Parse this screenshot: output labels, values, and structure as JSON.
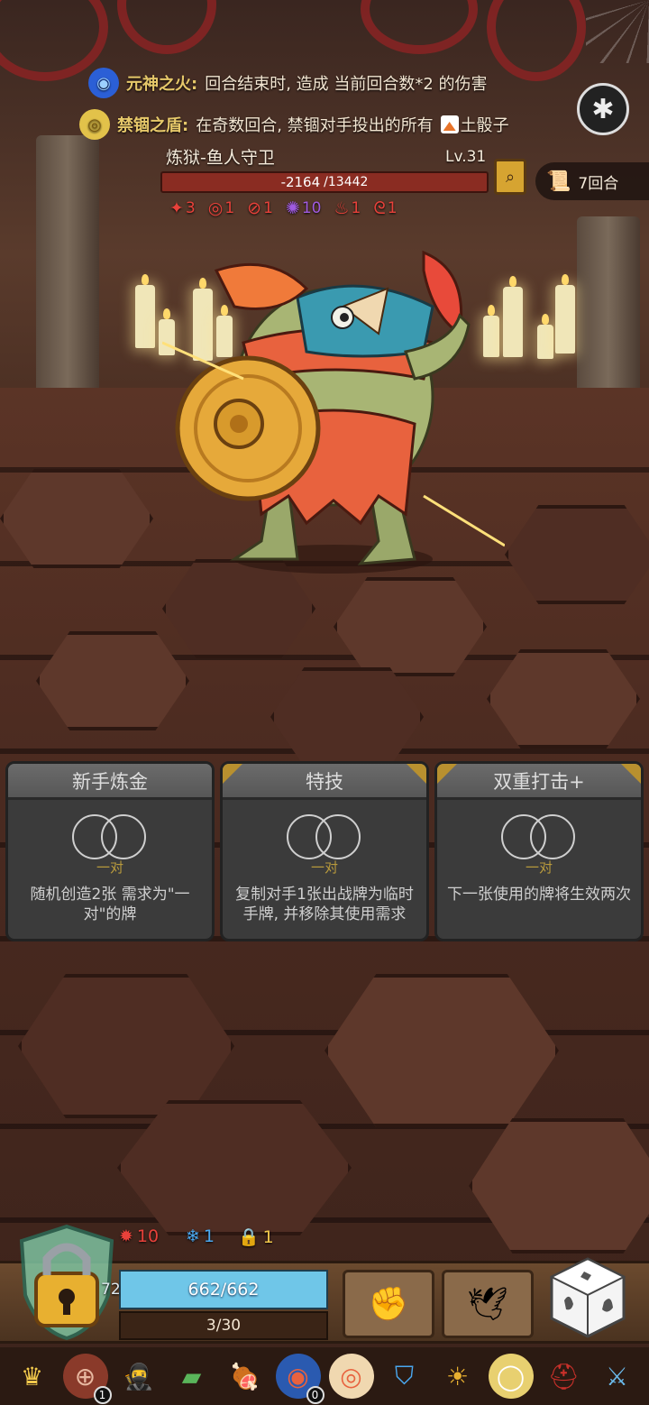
{
  "passives": [
    {
      "icon": "spirit-fire-icon",
      "name": "元神之火:",
      "text": "回合结束时, 造成 当前回合数*2 的伤害"
    },
    {
      "icon": "seal-shield-icon",
      "name": "禁锢之盾:",
      "text": "在奇数回合, 禁锢对手投出的所有",
      "dice_label": "土骰子"
    }
  ],
  "enemy": {
    "name": "炼狱-鱼人守卫",
    "level": "Lv.31",
    "hp_change": "-2164",
    "hp_max": "/13442",
    "hp_fraction": 0.84,
    "round_label": "7回合",
    "statuses": [
      {
        "icon": "burn-icon",
        "value": "3",
        "color": "#e8413a"
      },
      {
        "icon": "spiral-icon",
        "value": "1",
        "color": "#e8413a"
      },
      {
        "icon": "slash-icon",
        "value": "1",
        "color": "#e8413a"
      },
      {
        "icon": "poison-splat-icon",
        "value": "10",
        "color": "#a05be0"
      },
      {
        "icon": "rage-icon",
        "value": "1",
        "color": "#e8413a"
      },
      {
        "icon": "tentacle-icon",
        "value": "1",
        "color": "#e8413a"
      }
    ]
  },
  "cards": [
    {
      "title": "新手炼金",
      "requirement": "一对",
      "description": "随机创造2张 需求为\"一对\"的牌",
      "gold": false
    },
    {
      "title": "特技",
      "requirement": "一对",
      "description": "复制对手1张出战牌为临时手牌, 并移除其使用需求",
      "gold": true
    },
    {
      "title": "双重打击+",
      "requirement": "一对",
      "description": "下一张使用的牌将生效两次",
      "gold": true
    }
  ],
  "player": {
    "statuses": [
      {
        "icon": "burn-gear-icon",
        "value": "10",
        "color": "#e8413a"
      },
      {
        "icon": "snowflake-icon",
        "value": "1",
        "color": "#4aa8f0"
      },
      {
        "icon": "lock-icon",
        "value": "1",
        "color": "#f2c94c"
      }
    ],
    "shield_value": "72",
    "hp": "662/662",
    "hp_fraction": 1.0,
    "energy": "3/30",
    "energy_fraction": 0.1
  },
  "relics": [
    {
      "icon": "crown-icon",
      "badge": ""
    },
    {
      "icon": "button-icon",
      "badge": "1"
    },
    {
      "icon": "ninja-icon",
      "badge": ""
    },
    {
      "icon": "green-card-icon",
      "badge": ""
    },
    {
      "icon": "meat-icon",
      "badge": ""
    },
    {
      "icon": "pie-icon",
      "badge": "0"
    },
    {
      "icon": "donut-icon",
      "badge": ""
    },
    {
      "icon": "crystal-shield-icon",
      "badge": ""
    },
    {
      "icon": "tribal-mask-icon",
      "badge": ""
    },
    {
      "icon": "mirror-icon",
      "badge": ""
    },
    {
      "icon": "red-hood-icon",
      "badge": ""
    },
    {
      "icon": "ice-sword-icon",
      "badge": ""
    }
  ]
}
